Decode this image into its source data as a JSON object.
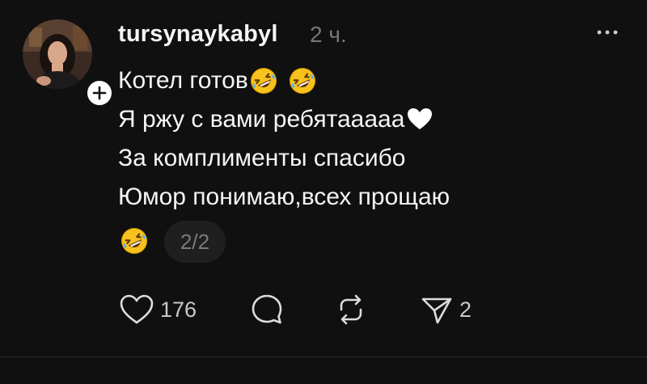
{
  "post": {
    "username": "tursynaykabyl",
    "timestamp": "2 ч.",
    "lines": [
      "Котел готов",
      "Я ржу с вами ребятааааа",
      "За комплименты спасибо",
      "Юмор понимаю,всех прощаю"
    ],
    "thread_position": "2/2"
  },
  "actions": {
    "likes": "176",
    "shares": "2"
  },
  "icons": {
    "laughing_emoji": "rolling-on-floor-laughing",
    "heart_emoji": "white-heart",
    "like": "heart-outline-icon",
    "comment": "speech-bubble-icon",
    "repost": "repost-arrows-icon",
    "share": "paper-plane-icon",
    "more": "ellipsis-icon"
  },
  "colors": {
    "background": "#101010",
    "text": "#f3f5f7",
    "secondary": "#777777",
    "emoji_yellow": "#f7c21c"
  }
}
